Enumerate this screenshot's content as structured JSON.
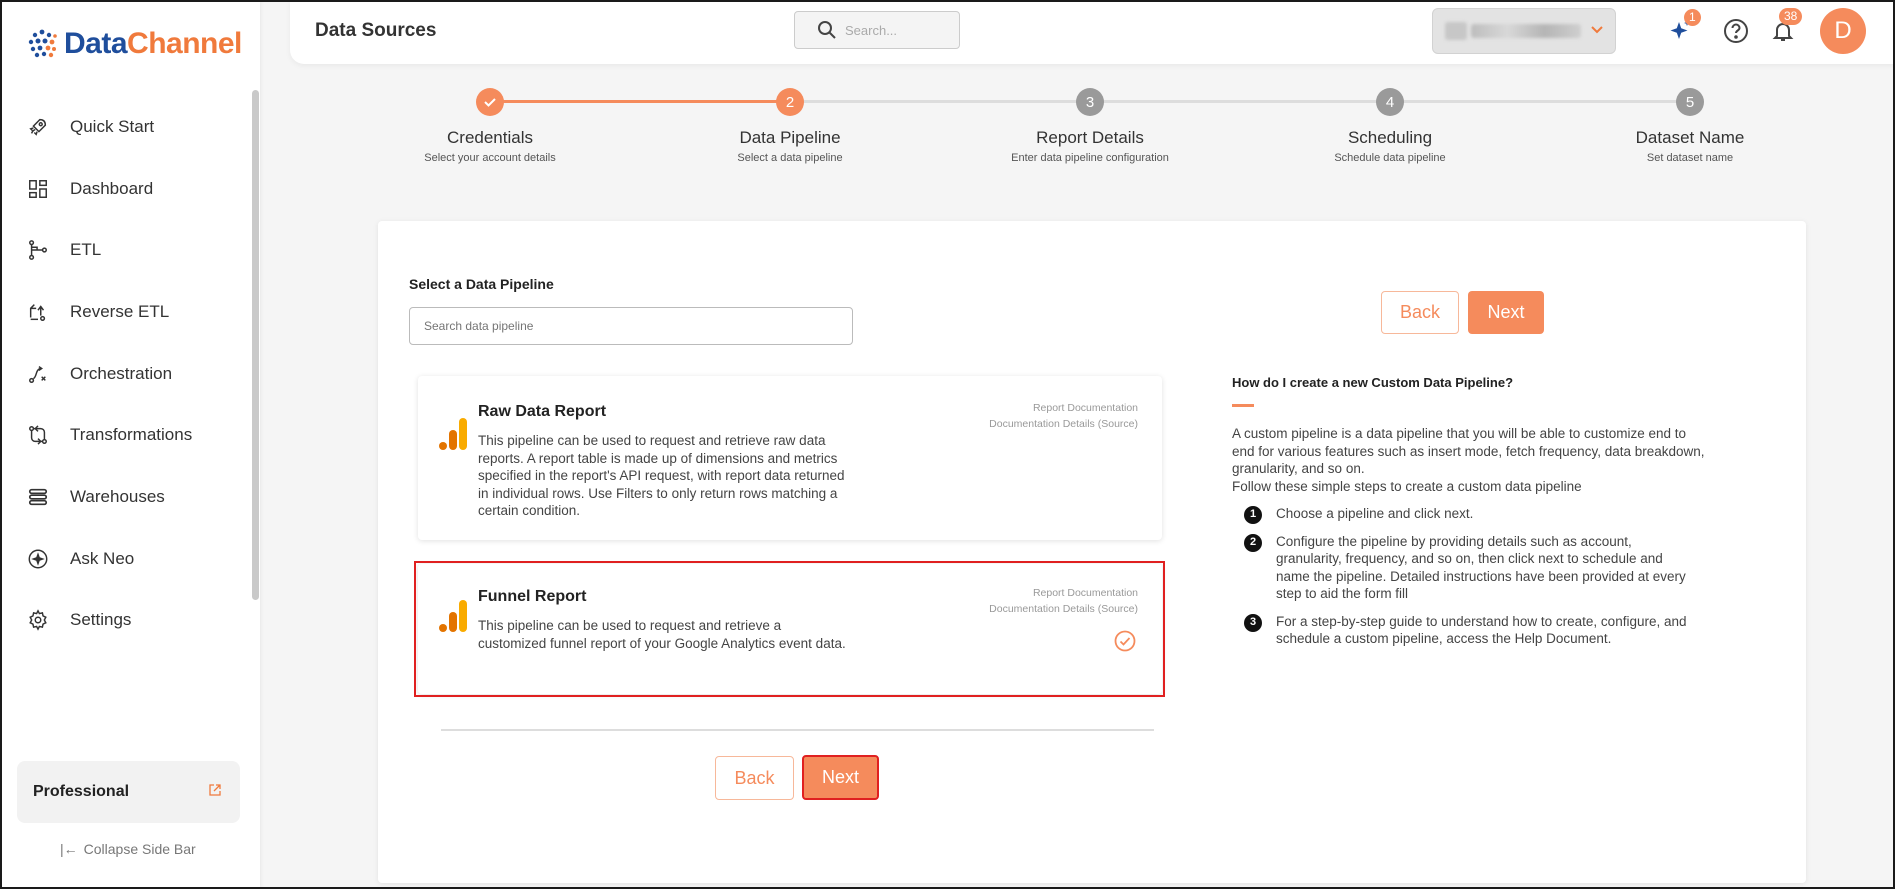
{
  "brand": {
    "name_part1": "Data",
    "name_part2": "Channel"
  },
  "sidebar": {
    "items": [
      {
        "label": "Quick Start",
        "icon": "rocket-icon"
      },
      {
        "label": "Dashboard",
        "icon": "dashboard-icon"
      },
      {
        "label": "ETL",
        "icon": "etl-icon"
      },
      {
        "label": "Reverse ETL",
        "icon": "reverse-etl-icon"
      },
      {
        "label": "Orchestration",
        "icon": "orchestration-icon"
      },
      {
        "label": "Transformations",
        "icon": "transformations-icon"
      },
      {
        "label": "Warehouses",
        "icon": "warehouses-icon"
      },
      {
        "label": "Ask Neo",
        "icon": "ask-neo-icon"
      },
      {
        "label": "Settings",
        "icon": "gear-icon"
      }
    ],
    "plan": "Professional",
    "collapse_label": "Collapse Side Bar"
  },
  "header": {
    "title": "Data Sources",
    "search_placeholder": "Search...",
    "ai_badge": "1",
    "notif_badge": "38",
    "avatar_letter": "D"
  },
  "stepper": {
    "steps": [
      {
        "num": "",
        "title": "Credentials",
        "sub": "Select your account details",
        "state": "done"
      },
      {
        "num": "2",
        "title": "Data Pipeline",
        "sub": "Select a data pipeline",
        "state": "active"
      },
      {
        "num": "3",
        "title": "Report Details",
        "sub": "Enter data pipeline configuration",
        "state": "pending"
      },
      {
        "num": "4",
        "title": "Scheduling",
        "sub": "Schedule data pipeline",
        "state": "pending"
      },
      {
        "num": "5",
        "title": "Dataset Name",
        "sub": "Set dataset name",
        "state": "pending"
      }
    ]
  },
  "main": {
    "select_label": "Select a Data Pipeline",
    "search_placeholder": "Search data pipeline",
    "back_label": "Back",
    "next_label": "Next",
    "pipelines": [
      {
        "title": "Raw Data Report",
        "description": "This pipeline can be used to request and retrieve raw data reports. A report table is made up of dimensions and metrics specified in the report's API request, with report data returned in individual rows. Use Filters to only return rows matching a certain condition.",
        "doc1": "Report Documentation",
        "doc2": "Documentation Details (Source)"
      },
      {
        "title": "Funnel Report",
        "description": "This pipeline can be used to request and retrieve a customized funnel report of your Google Analytics event data.",
        "doc1": "Report Documentation",
        "doc2": "Documentation Details (Source)",
        "selected": true
      }
    ]
  },
  "help": {
    "title": "How do I create a new Custom Data Pipeline?",
    "intro": "A custom pipeline is a data pipeline that you will be able to customize end to end for various features such as insert mode, fetch frequency, data breakdown, granularity, and so on.",
    "intro2": "Follow these simple steps to create a custom data pipeline",
    "steps": [
      {
        "num": "1",
        "text": "Choose a pipeline and click next."
      },
      {
        "num": "2",
        "text": "Configure the pipeline by providing details such as account, granularity, frequency, and so on, then click next to schedule and name the pipeline. Detailed instructions have been provided at every step to aid the form fill"
      },
      {
        "num": "3",
        "text": "For a step-by-step guide to understand how to create, configure, and schedule a custom pipeline, access the Help Document."
      }
    ]
  },
  "colors": {
    "accent": "#f58b5c",
    "brand_blue": "#1f4e9c",
    "selected_border": "#e02020"
  }
}
